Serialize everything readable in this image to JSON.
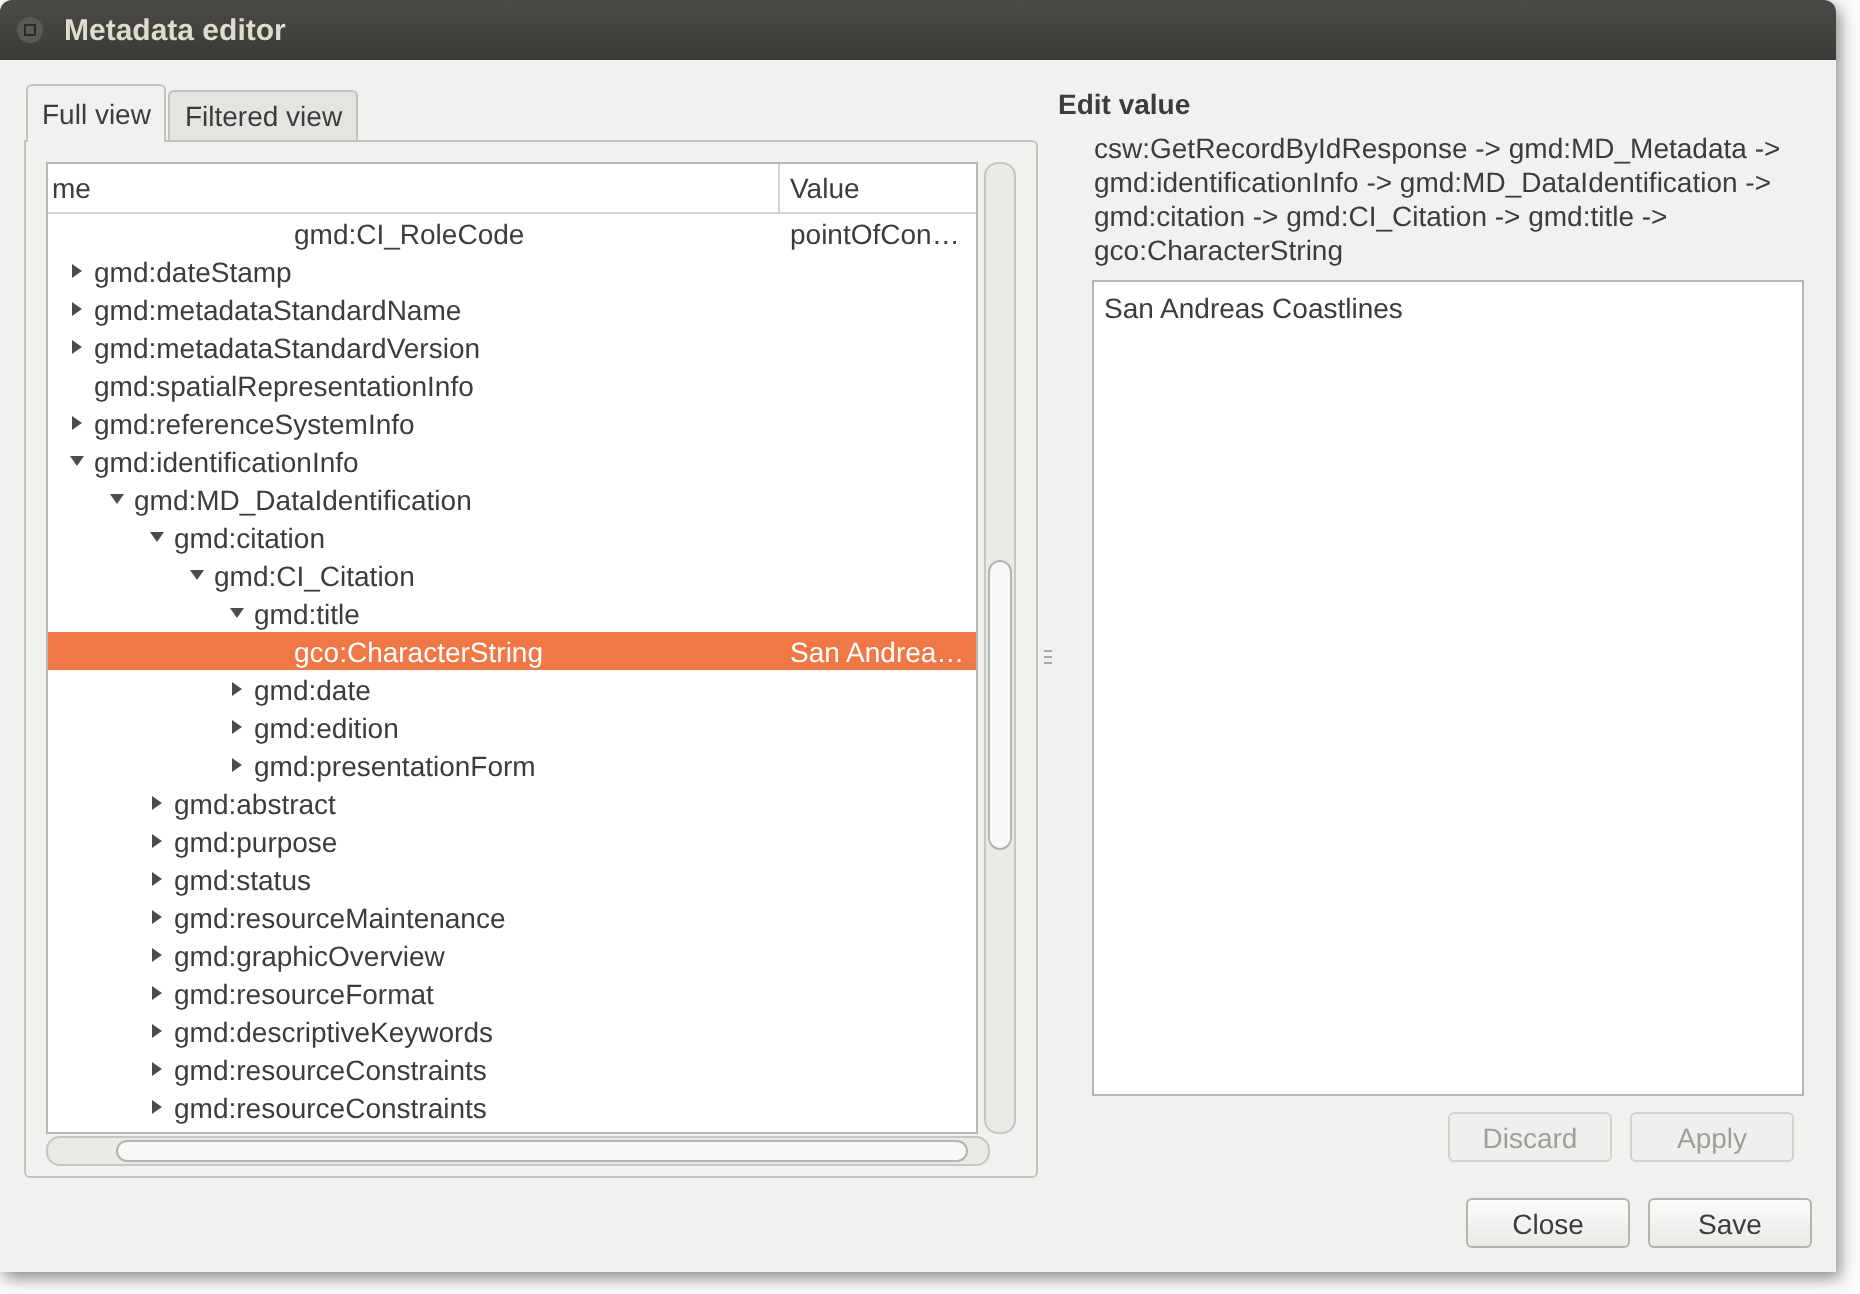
{
  "window": {
    "title": "Metadata editor"
  },
  "tabs": [
    {
      "label": "Full view",
      "selected": true
    },
    {
      "label": "Filtered view",
      "selected": false
    }
  ],
  "tree": {
    "columns": [
      "me",
      "Value"
    ],
    "top_row": {
      "label": "gmd:CI_RoleCode",
      "value": "pointOfCon…",
      "selected": false
    },
    "rows": [
      {
        "label": "gmd:dateStamp",
        "expanded": false,
        "selected": false
      },
      {
        "label": "gmd:metadataStandardName",
        "expanded": false,
        "selected": false
      },
      {
        "label": "gmd:metadataStandardVersion",
        "expanded": false,
        "selected": false
      },
      {
        "label": "gmd:spatialRepresentationInfo",
        "selected": false
      },
      {
        "label": "gmd:referenceSystemInfo",
        "expanded": false,
        "selected": false
      },
      {
        "label": "gmd:identificationInfo",
        "expanded": true,
        "selected": false,
        "children": [
          {
            "label": "gmd:MD_DataIdentification",
            "expanded": true,
            "selected": false,
            "children": [
              {
                "label": "gmd:citation",
                "expanded": true,
                "selected": false,
                "children": [
                  {
                    "label": "gmd:CI_Citation",
                    "expanded": true,
                    "selected": false,
                    "children": [
                      {
                        "label": "gmd:title",
                        "expanded": true,
                        "selected": false,
                        "children": [
                          {
                            "label": "gco:CharacterString",
                            "value": "San Andrea…",
                            "selected": true
                          }
                        ]
                      },
                      {
                        "label": "gmd:date",
                        "expanded": false,
                        "selected": false
                      },
                      {
                        "label": "gmd:edition",
                        "expanded": false,
                        "selected": false
                      },
                      {
                        "label": "gmd:presentationForm",
                        "expanded": false,
                        "selected": false
                      }
                    ]
                  }
                ]
              },
              {
                "label": "gmd:abstract",
                "expanded": false,
                "selected": false
              },
              {
                "label": "gmd:purpose",
                "expanded": false,
                "selected": false
              },
              {
                "label": "gmd:status",
                "expanded": false,
                "selected": false
              },
              {
                "label": "gmd:resourceMaintenance",
                "expanded": false,
                "selected": false
              },
              {
                "label": "gmd:graphicOverview",
                "expanded": false,
                "selected": false
              },
              {
                "label": "gmd:resourceFormat",
                "expanded": false,
                "selected": false
              },
              {
                "label": "gmd:descriptiveKeywords",
                "expanded": false,
                "selected": false
              },
              {
                "label": "gmd:resourceConstraints",
                "expanded": false,
                "selected": false
              },
              {
                "label": "gmd:resourceConstraints",
                "expanded": false,
                "selected": false
              }
            ]
          }
        ]
      }
    ]
  },
  "editor": {
    "heading": "Edit value",
    "path": "csw:GetRecordByIdResponse -> gmd:MD_Metadata -> gmd:identificationInfo -> gmd:MD_DataIdentification -> gmd:citation -> gmd:CI_Citation -> gmd:title -> gco:CharacterString",
    "value": "San Andreas Coastlines",
    "buttons": [
      {
        "label": "Discard",
        "disabled": true
      },
      {
        "label": "Apply",
        "disabled": true
      }
    ]
  },
  "footer_buttons": [
    {
      "label": "Close",
      "disabled": false
    },
    {
      "label": "Save",
      "disabled": false
    }
  ]
}
